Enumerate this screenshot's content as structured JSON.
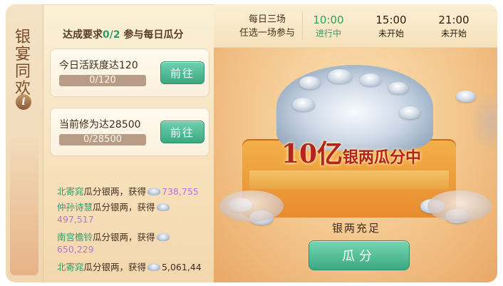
{
  "event": {
    "title_chars": [
      "银",
      "宴",
      "同",
      "欢"
    ],
    "info_icon": "i"
  },
  "requirements": {
    "prefix": "达成要求",
    "progress": "0/2",
    "suffix": "参与每日瓜分"
  },
  "tasks": [
    {
      "label": "今日活跃度达120",
      "progress_text": "0/120",
      "progress_fraction": 0,
      "button": "前往"
    },
    {
      "label": "当前修为达28500",
      "progress_text": "0/28500",
      "progress_fraction": 0,
      "button": "前往"
    }
  ],
  "log": [
    {
      "name": "北寄窕",
      "text": "瓜分银两，获得",
      "amount": "738,755"
    },
    {
      "name": "仲孙诗慧",
      "text": "瓜分银两，获得",
      "amount": "497,517"
    },
    {
      "name": "南宫檐铃",
      "text": "瓜分银两，获得",
      "amount": "650,229"
    },
    {
      "name": "北寄窕",
      "text": "瓜分银两，获得",
      "amount": "5,061,44"
    }
  ],
  "schedule": {
    "title_line1": "每日三场",
    "title_line2": "任选一场参与",
    "slots": [
      {
        "time": "10:00",
        "status": "进行中",
        "active": true
      },
      {
        "time": "15:00",
        "status": "未开始",
        "active": false
      },
      {
        "time": "21:00",
        "status": "未开始",
        "active": false
      }
    ]
  },
  "prize": {
    "big_number": "10亿",
    "big_text": "银两瓜分中",
    "stock_label": "银两充足",
    "claim_button": "瓜分"
  },
  "colors": {
    "accent_green": "#2f9d6a",
    "amount_purple": "#b574d7",
    "title_red": "#b4241d"
  },
  "icons": [
    "info-icon",
    "silver-ingot-icon"
  ]
}
